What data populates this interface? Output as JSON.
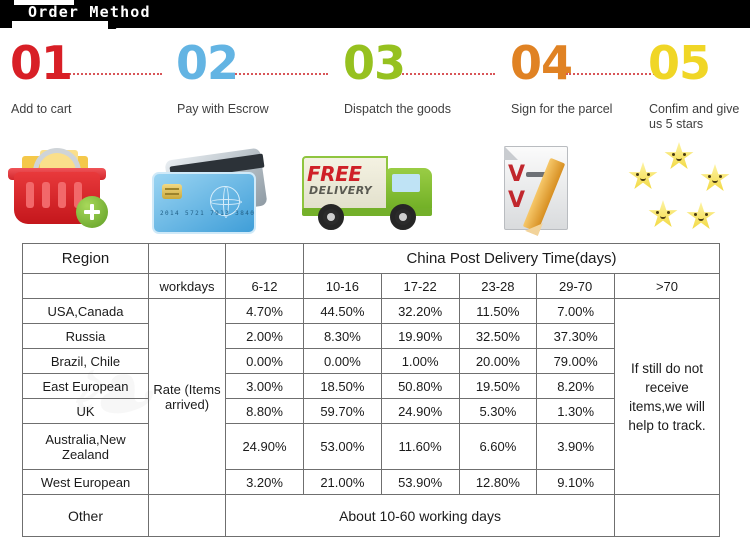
{
  "banner": {
    "title": "Order Method"
  },
  "steps": [
    {
      "num": "01",
      "label": "Add to cart",
      "color": "#d81f26",
      "icon": "shopping-basket-add-icon"
    },
    {
      "num": "02",
      "label": "Pay with Escrow",
      "color": "#63b4e3",
      "icon": "credit-card-icon"
    },
    {
      "num": "03",
      "label": "Dispatch the goods",
      "color": "#96c11f",
      "icon": "free-delivery-truck-icon"
    },
    {
      "num": "04",
      "label": "Sign for the parcel",
      "color": "#e08223",
      "icon": "signed-document-pencil-icon"
    },
    {
      "num": "05",
      "label": "Confim and give us 5 stars",
      "color": "#f0d626",
      "icon": "five-stars-icon"
    }
  ],
  "icon_text": {
    "card_number": "2014  5721  7913  3840",
    "truck_free": "FREE",
    "truck_delivery": "DELIVERY"
  },
  "table": {
    "region_header": "Region",
    "span_header": "China Post  Delivery Time(days)",
    "workdays_header": "workdays",
    "day_ranges": [
      "6-12",
      "10-16",
      "17-22",
      "23-28",
      "29-70",
      ">70"
    ],
    "rate_label": "Rate (Items arrived)",
    "rows": [
      {
        "region": "USA,Canada",
        "values": [
          "4.70%",
          "44.50%",
          "32.20%",
          "11.50%",
          "7.00%"
        ]
      },
      {
        "region": "Russia",
        "values": [
          "2.00%",
          "8.30%",
          "19.90%",
          "32.50%",
          "37.30%"
        ]
      },
      {
        "region": "Brazil, Chile",
        "values": [
          "0.00%",
          "0.00%",
          "1.00%",
          "20.00%",
          "79.00%"
        ]
      },
      {
        "region": "East European",
        "values": [
          "3.00%",
          "18.50%",
          "50.80%",
          "19.50%",
          "8.20%"
        ]
      },
      {
        "region": "UK",
        "values": [
          "8.80%",
          "59.70%",
          "24.90%",
          "5.30%",
          "1.30%"
        ]
      },
      {
        "region": "Australia,New Zealand",
        "values": [
          "24.90%",
          "53.00%",
          "11.60%",
          "6.60%",
          "3.90%"
        ]
      },
      {
        "region": "West European",
        "values": [
          "3.20%",
          "21.00%",
          "53.90%",
          "12.80%",
          "9.10%"
        ]
      }
    ],
    "other_region": "Other",
    "other_note": "About 10-60 working days",
    "track_note": "If still do not receive items,we will help to track."
  },
  "colors": {
    "banner_bg": "#000000",
    "table_border": "#6f6f6f",
    "dot_line": "#d2383c"
  }
}
